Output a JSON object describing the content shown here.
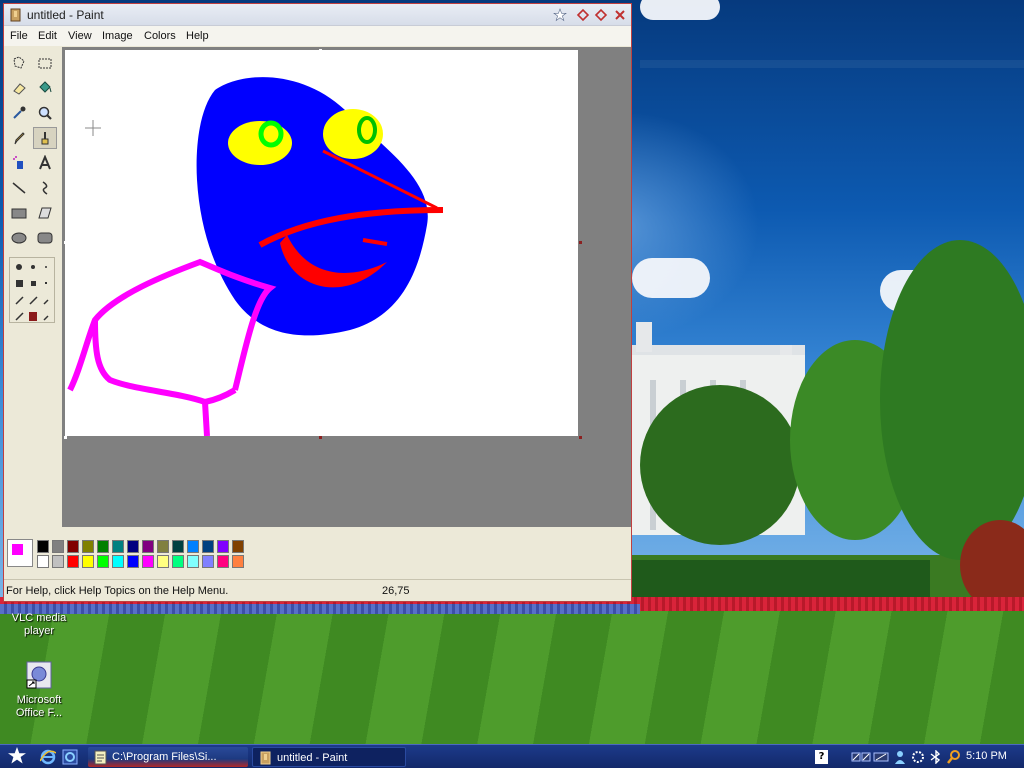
{
  "window": {
    "title": "untitled - Paint",
    "controls": [
      "minimize",
      "restore",
      "close"
    ]
  },
  "menu": {
    "items": [
      "File",
      "Edit",
      "View",
      "Image",
      "Colors",
      "Help"
    ]
  },
  "toolbox": {
    "tools": [
      {
        "name": "free-form-select",
        "icon": "free-select-icon"
      },
      {
        "name": "select",
        "icon": "rect-select-icon"
      },
      {
        "name": "eraser",
        "icon": "eraser-icon"
      },
      {
        "name": "fill",
        "icon": "fill-bucket-icon"
      },
      {
        "name": "pick-color",
        "icon": "eyedropper-icon"
      },
      {
        "name": "magnifier",
        "icon": "magnifier-icon"
      },
      {
        "name": "pencil",
        "icon": "pencil-icon"
      },
      {
        "name": "brush",
        "icon": "brush-icon",
        "selected": true
      },
      {
        "name": "airbrush",
        "icon": "airbrush-icon"
      },
      {
        "name": "text",
        "icon": "text-icon"
      },
      {
        "name": "line",
        "icon": "line-icon"
      },
      {
        "name": "curve",
        "icon": "curve-icon"
      },
      {
        "name": "rectangle",
        "icon": "rectangle-icon"
      },
      {
        "name": "polygon",
        "icon": "polygon-icon"
      },
      {
        "name": "ellipse",
        "icon": "ellipse-icon"
      },
      {
        "name": "rounded-rectangle",
        "icon": "rounded-rect-icon"
      }
    ]
  },
  "palette": {
    "foreground": "#ff00ff",
    "background": "#ffffff",
    "row1": [
      "#000000",
      "#808080",
      "#800000",
      "#808000",
      "#008000",
      "#008080",
      "#000080",
      "#800080",
      "#808040",
      "#004040",
      "#0080ff",
      "#004080",
      "#8000ff",
      "#804000"
    ],
    "row2": [
      "#ffffff",
      "#c0c0c0",
      "#ff0000",
      "#ffff00",
      "#00ff00",
      "#00ffff",
      "#0000ff",
      "#ff00ff",
      "#ffff80",
      "#00ff80",
      "#80ffff",
      "#8080ff",
      "#ff0080",
      "#ff8040"
    ]
  },
  "status": {
    "help_text": "For Help, click Help Topics on the Help Menu.",
    "coordinates": "26,75"
  },
  "desktop_icons": [
    {
      "label": "VLC media player",
      "icon": "vlc-icon"
    },
    {
      "label": "Microsoft Office F...",
      "icon": "office-shortcut-icon"
    }
  ],
  "taskbar": {
    "tasks": [
      {
        "label": "C:\\Program Files\\Si...",
        "icon": "notepad-icon",
        "active": false
      },
      {
        "label": "untitled - Paint",
        "icon": "paint-icon",
        "active": true
      }
    ],
    "quick_launch": [
      "ie-icon",
      "ie-icon-2"
    ],
    "tray_help": "?",
    "clock": "5:10 PM"
  }
}
